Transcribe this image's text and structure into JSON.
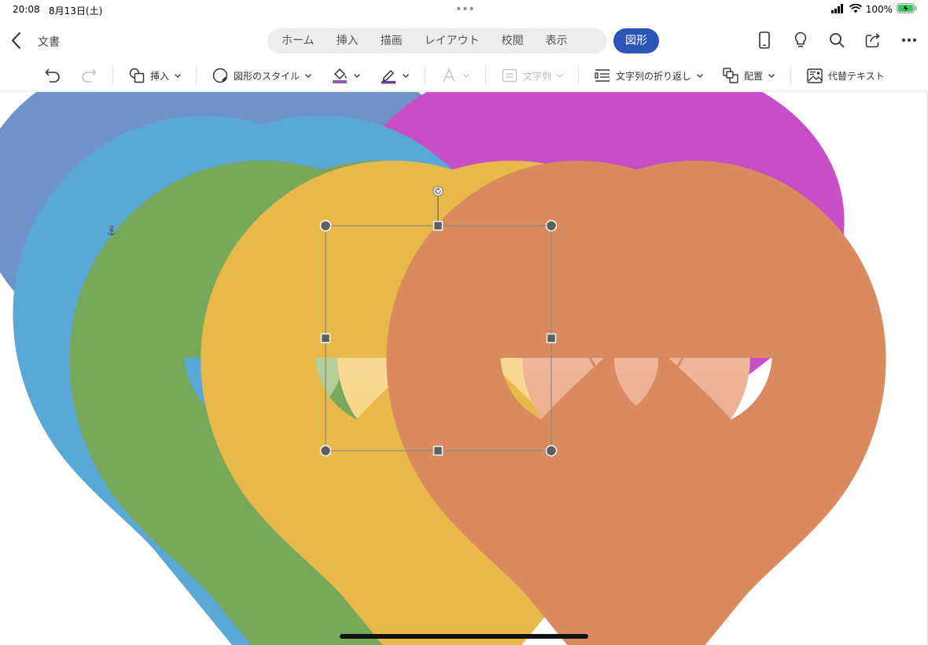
{
  "status": {
    "time": "20:08",
    "date": "8月13日(土)",
    "multitask": "•••",
    "battery": "100%"
  },
  "header": {
    "doc_title": "文書",
    "tabs": [
      {
        "label": "ホーム"
      },
      {
        "label": "挿入"
      },
      {
        "label": "描画"
      },
      {
        "label": "レイアウト"
      },
      {
        "label": "校閲"
      },
      {
        "label": "表示"
      }
    ],
    "active_tab": "図形"
  },
  "ribbon": {
    "insert": "挿入",
    "shape_styles": "図形のスタイル",
    "text_direction": "文字列",
    "wrap_text": "文字列の折り返し",
    "arrange": "配置",
    "alt_text": "代替テキスト"
  },
  "shapes": [
    {
      "name": "heart-blue",
      "fill_top": "#b3c9e8",
      "fill_bottom": "#93aed9",
      "stroke": "#6f93c9"
    },
    {
      "name": "heart-purple",
      "fill_top": "#9a6cc9",
      "fill_bottom": "#a781d4",
      "stroke": "#7a4aa8"
    },
    {
      "name": "heart-magenta",
      "fill_top": "#ee8cf0",
      "fill_bottom": "#e67ae6",
      "stroke": "#c84ec8"
    },
    {
      "name": "heart-lightblue",
      "fill_top": "#a8ddf7",
      "fill_bottom": "#8fd3f5",
      "stroke": "#5aa8d6"
    },
    {
      "name": "heart-green",
      "fill_top": "#bfd6a8",
      "fill_bottom": "#9cc47c",
      "stroke": "#78a85a"
    },
    {
      "name": "heart-yellow",
      "fill_top": "#f9dba4",
      "fill_bottom": "#f8d273",
      "stroke": "#e8b84a"
    },
    {
      "name": "heart-orange",
      "fill_top": "#efbfa8",
      "fill_bottom": "#eba27c",
      "stroke": "#d98a5e"
    }
  ],
  "colors": {
    "accent": "#2b55b7",
    "fill_icon_bar": "#8b5fb0",
    "line_icon_bar": "#6a3fa0"
  }
}
